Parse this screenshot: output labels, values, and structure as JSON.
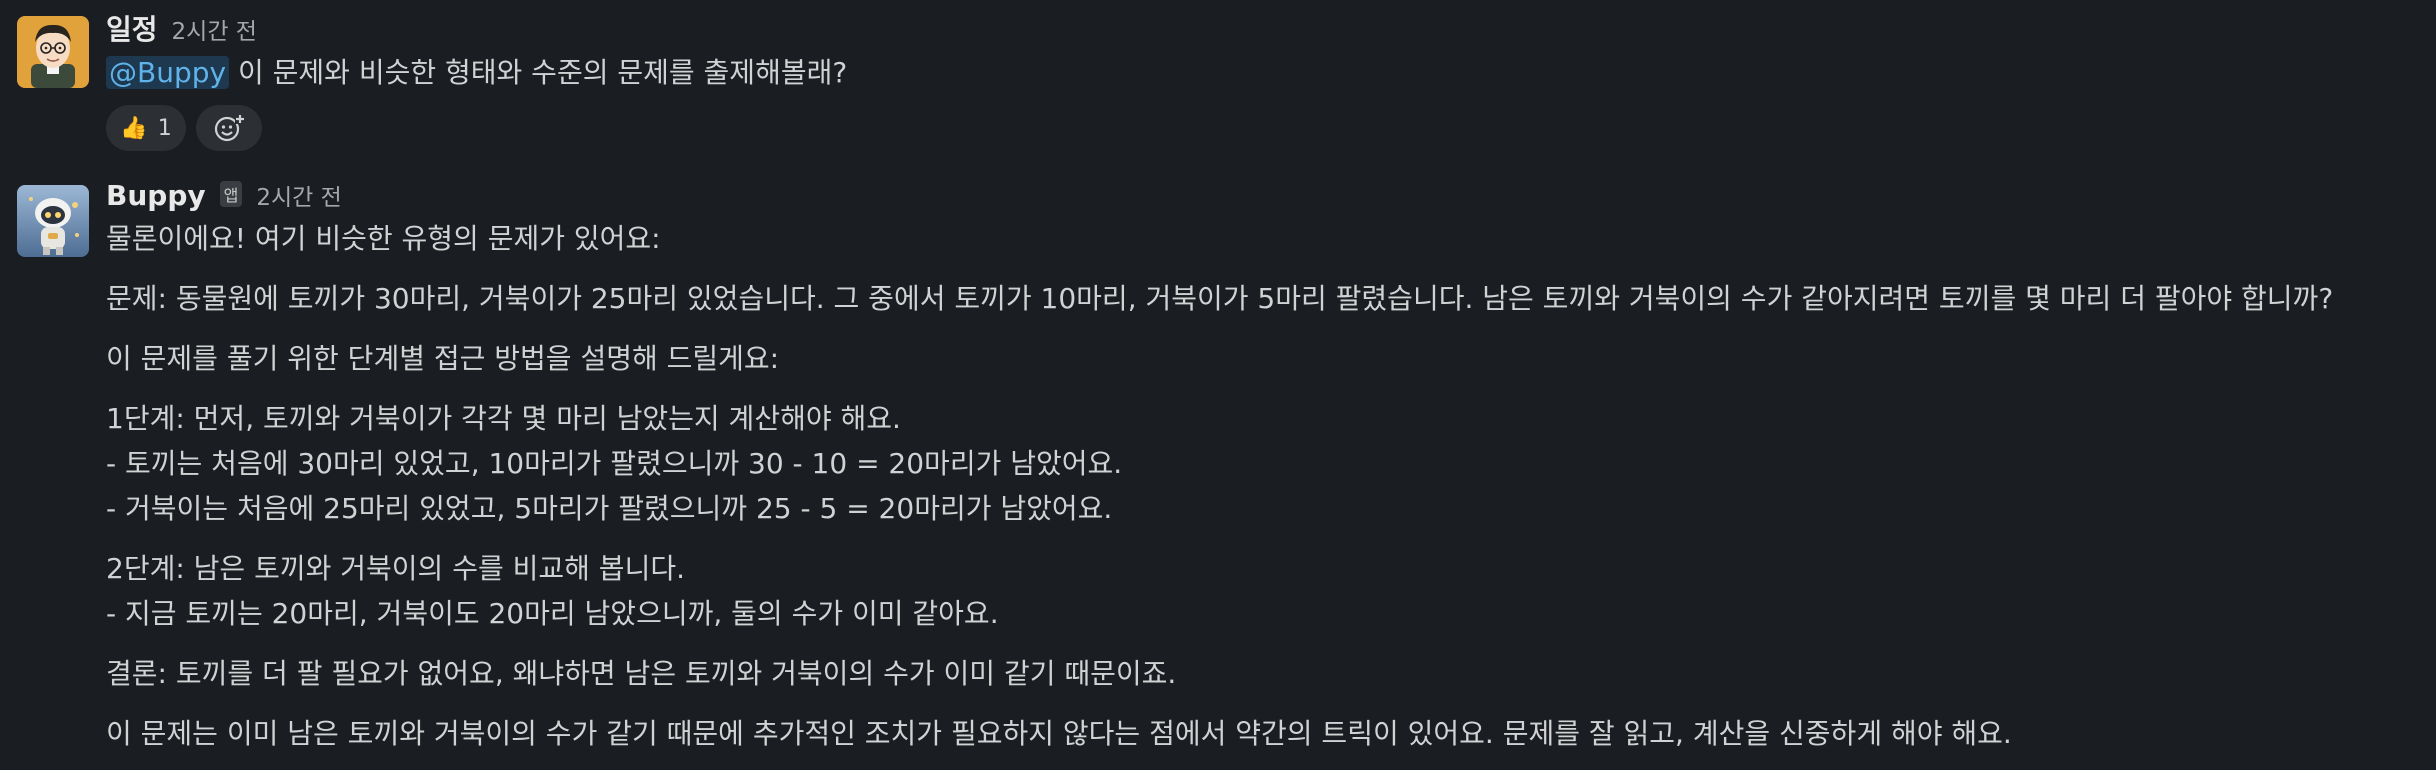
{
  "messages": [
    {
      "author": "일정",
      "time": "2시간 전",
      "mention": "@Buppy",
      "text": "이 문제와 비슷한 형태와 수준의 문제를 출제해볼래?",
      "reactions": [
        {
          "icon": "thumbs-up-icon",
          "emoji": "👍",
          "count": "1"
        }
      ]
    },
    {
      "author": "Buppy",
      "badge": "앱",
      "time": "2시간 전",
      "paragraphs": [
        [
          "물론이에요! 여기 비슷한 유형의 문제가 있어요:"
        ],
        [
          "문제: 동물원에 토끼가 30마리, 거북이가 25마리 있었습니다. 그 중에서 토끼가 10마리, 거북이가 5마리 팔렸습니다. 남은 토끼와 거북이의 수가 같아지려면 토끼를 몇 마리 더 팔아야 합니까?"
        ],
        [
          "이 문제를 풀기 위한 단계별 접근 방법을 설명해 드릴게요:"
        ],
        [
          "1단계: 먼저, 토끼와 거북이가 각각 몇 마리 남았는지 계산해야 해요.",
          "- 토끼는 처음에 30마리 있었고, 10마리가 팔렸으니까 30 - 10 = 20마리가 남았어요.",
          "- 거북이는 처음에 25마리 있었고, 5마리가 팔렸으니까 25 - 5 = 20마리가 남았어요."
        ],
        [
          "2단계: 남은 토끼와 거북이의 수를 비교해 봅니다.",
          "- 지금 토끼는 20마리, 거북이도 20마리 남았으니까, 둘의 수가 이미 같아요."
        ],
        [
          "결론: 토끼를 더 팔 필요가 없어요, 왜냐하면 남은 토끼와 거북이의 수가 이미 같기 때문이죠."
        ],
        [
          "이 문제는 이미 남은 토끼와 거북이의 수가 같기 때문에 추가적인 조치가 필요하지 않다는 점에서 약간의 트릭이 있어요. 문제를 잘 읽고, 계산을 신중하게 해야 해요."
        ]
      ]
    }
  ],
  "colors": {
    "background": "#1a1d21",
    "text": "#d1d2d3",
    "mention": "#5fb3e8",
    "reaction_bg": "#2c2f33"
  },
  "icons": {
    "add_reaction": "add-reaction-icon",
    "user_avatar": "avatar",
    "bot_avatar": "bot-avatar"
  }
}
